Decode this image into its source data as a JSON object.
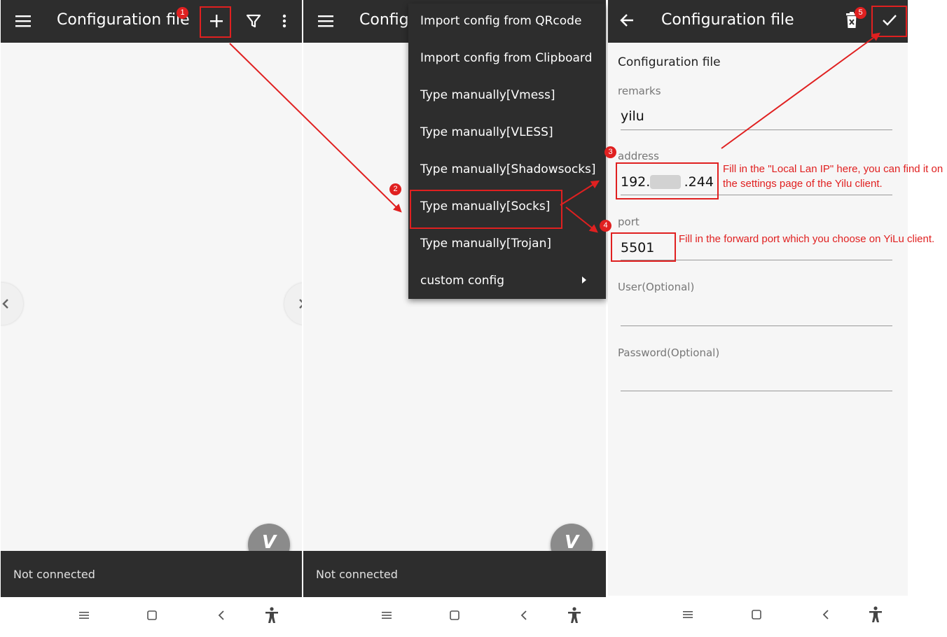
{
  "panel1": {
    "title": "Configuration file",
    "status": "Not connected",
    "fab_label": "V"
  },
  "panel2": {
    "title": "Config",
    "menu": [
      "Import config from QRcode",
      "Import config from Clipboard",
      "Type manually[Vmess]",
      "Type manually[VLESS]",
      "Type manually[Shadowsocks]",
      "Type manually[Socks]",
      "Type manually[Trojan]",
      "custom config"
    ],
    "status": "Not connected",
    "fab_label": "V"
  },
  "panel3": {
    "title": "Configuration file",
    "section_title": "Configuration file",
    "remarks_label": "remarks",
    "remarks_value": "yilu",
    "address_label": "address",
    "address_value": "192.        .244",
    "port_label": "port",
    "port_value": "5501",
    "user_label": "User(Optional)",
    "password_label": "Password(Optional)"
  },
  "annotations": {
    "steps": [
      "1",
      "2",
      "3",
      "4",
      "5"
    ],
    "note_address": "Fill in the \"Local Lan IP\" here, you can find it on the settings page of the Yilu client.",
    "note_port": "Fill in the forward port which you choose on YiLu client."
  },
  "colors": {
    "bar": "#2d2d2d",
    "annotation": "#e02020",
    "background": "#f6f6f6"
  },
  "icons": [
    "menu-icon",
    "plus-icon",
    "filter-icon",
    "more-vert-icon",
    "back-arrow-icon",
    "delete-icon",
    "check-icon",
    "chevron-right-icon",
    "nav-menu-icon",
    "nav-home-icon",
    "nav-back-icon",
    "accessibility-icon"
  ]
}
